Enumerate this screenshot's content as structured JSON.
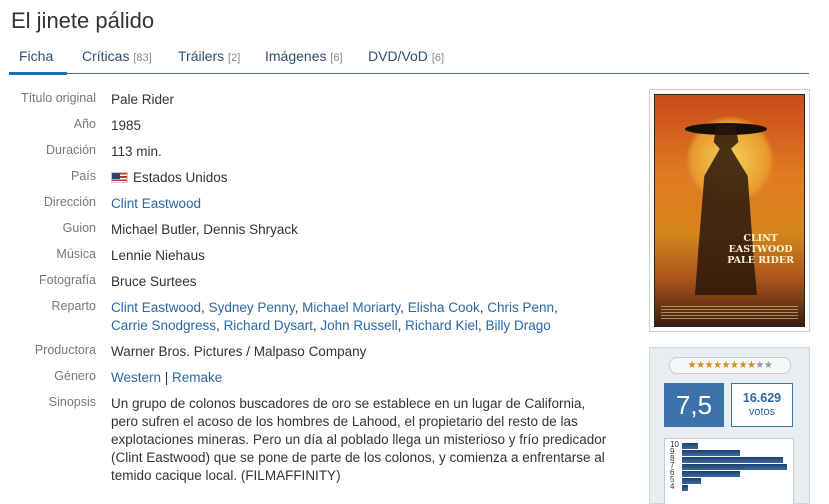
{
  "page_title": "El jinete pálido",
  "tabs": [
    {
      "label": "Ficha",
      "count": ""
    },
    {
      "label": "Críticas",
      "count": "[83]"
    },
    {
      "label": "Tráilers",
      "count": "[2]"
    },
    {
      "label": "Imágenes",
      "count": "[6]"
    },
    {
      "label": "DVD/VoD",
      "count": "[6]"
    }
  ],
  "info": {
    "titulo_original": {
      "label": "Título original",
      "value": "Pale Rider"
    },
    "anio": {
      "label": "Año",
      "value": "1985"
    },
    "duracion": {
      "label": "Duración",
      "value": "113 min."
    },
    "pais": {
      "label": "País",
      "value": "Estados Unidos"
    },
    "direccion": {
      "label": "Dirección",
      "value": "Clint Eastwood"
    },
    "guion": {
      "label": "Guion",
      "value": "Michael Butler, Dennis Shryack"
    },
    "musica": {
      "label": "Música",
      "value": "Lennie Niehaus"
    },
    "fotografia": {
      "label": "Fotografía",
      "value": "Bruce Surtees"
    },
    "reparto": {
      "label": "Reparto",
      "people": [
        "Clint Eastwood",
        "Sydney Penny",
        "Michael Moriarty",
        "Elisha Cook",
        "Chris Penn",
        "Carrie Snodgress",
        "Richard Dysart",
        "John Russell",
        "Richard Kiel",
        "Billy Drago"
      ]
    },
    "productora": {
      "label": "Productora",
      "value": "Warner Bros. Pictures / Malpaso Company"
    },
    "genero": {
      "label": "Género",
      "items": [
        "Western",
        "Remake"
      ]
    },
    "sinopsis": {
      "label": "Sinopsis",
      "value": "Un grupo de colonos buscadores de oro se establece en un lugar de California, pero sufren el acoso de los hombres de Lahood, el propietario del resto de las explotaciones mineras. Pero un día al poblado llega un misterioso y frío predicador (Clint Eastwood) que se pone de parte de los colonos, y comienza a enfrentarse al temido cacique local. (FILMAFFINITY)"
    }
  },
  "poster": {
    "title_line1": "CLINT",
    "title_line2": "EASTWOOD",
    "title_line3": "PALE RIDER"
  },
  "rating": {
    "stars_on": 8,
    "stars_total": 10,
    "average": "7,5",
    "votes_count": "16.629",
    "votes_label": "votos",
    "histogram_labels": [
      "10",
      "9",
      "8",
      "7",
      "6",
      "5",
      "4"
    ],
    "histogram_fraction": [
      0.15,
      0.55,
      0.96,
      1.0,
      0.55,
      0.18,
      0.06
    ]
  },
  "colors": {
    "link": "#2b67a5",
    "accent": "#1a6fb0",
    "rating_bg": "#3b72a8"
  }
}
